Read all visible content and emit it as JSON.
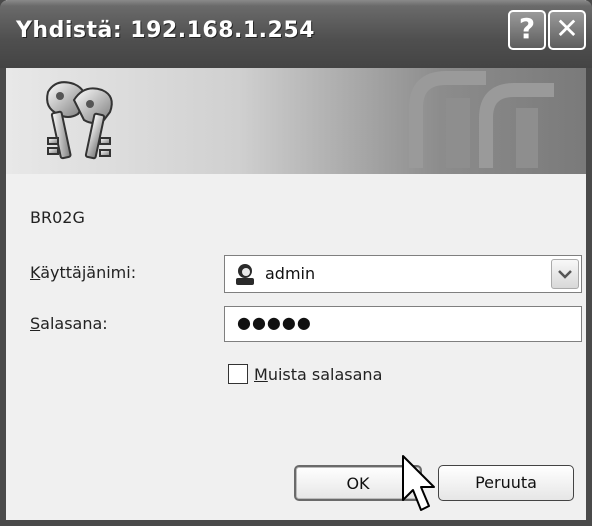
{
  "dialog": {
    "title": "Yhdistä: 192.168.1.254",
    "help_button": "?",
    "close_button": "✕"
  },
  "form": {
    "realm": "BR02G",
    "username_label": {
      "accel": "K",
      "rest": "äyttäjänimi:"
    },
    "username_value": "admin",
    "password_label": {
      "accel": "S",
      "rest": "alasana:"
    },
    "password_value": "●●●●●",
    "remember_label": {
      "accel": "M",
      "rest": "uista salasana"
    },
    "remember_checked": false
  },
  "buttons": {
    "ok": "OK",
    "cancel": "Peruuta"
  }
}
